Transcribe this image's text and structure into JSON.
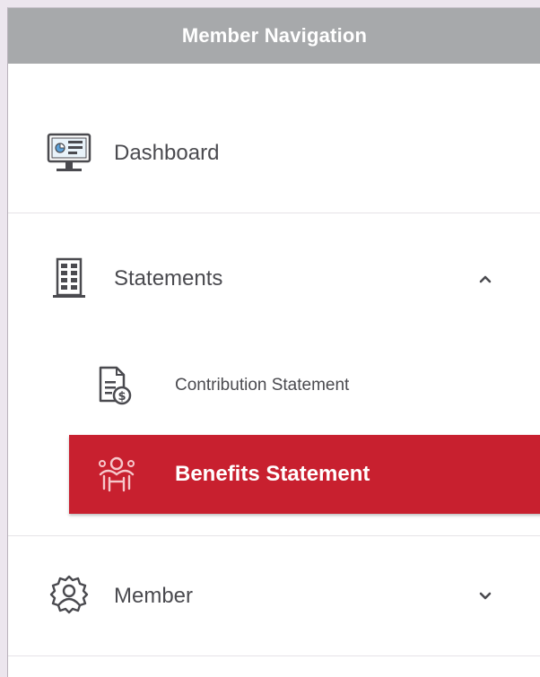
{
  "nav": {
    "header": "Member Navigation",
    "items": [
      {
        "label": "Dashboard",
        "icon": "dashboard-monitor-icon"
      },
      {
        "label": "Statements",
        "icon": "statements-building-icon",
        "expanded": true
      },
      {
        "label": "Member",
        "icon": "member-settings-icon",
        "expanded": false
      }
    ],
    "sub_items": [
      {
        "label": "Contribution Statement",
        "icon": "contribution-document-dollar-icon"
      },
      {
        "label": "Benefits Statement",
        "icon": "benefits-hands-icon",
        "active": true
      }
    ]
  },
  "colors": {
    "header_bg": "#a7a9ab",
    "active_bg": "#c8202f",
    "text": "#4a4a4f",
    "page_bg": "#ece6ee"
  }
}
